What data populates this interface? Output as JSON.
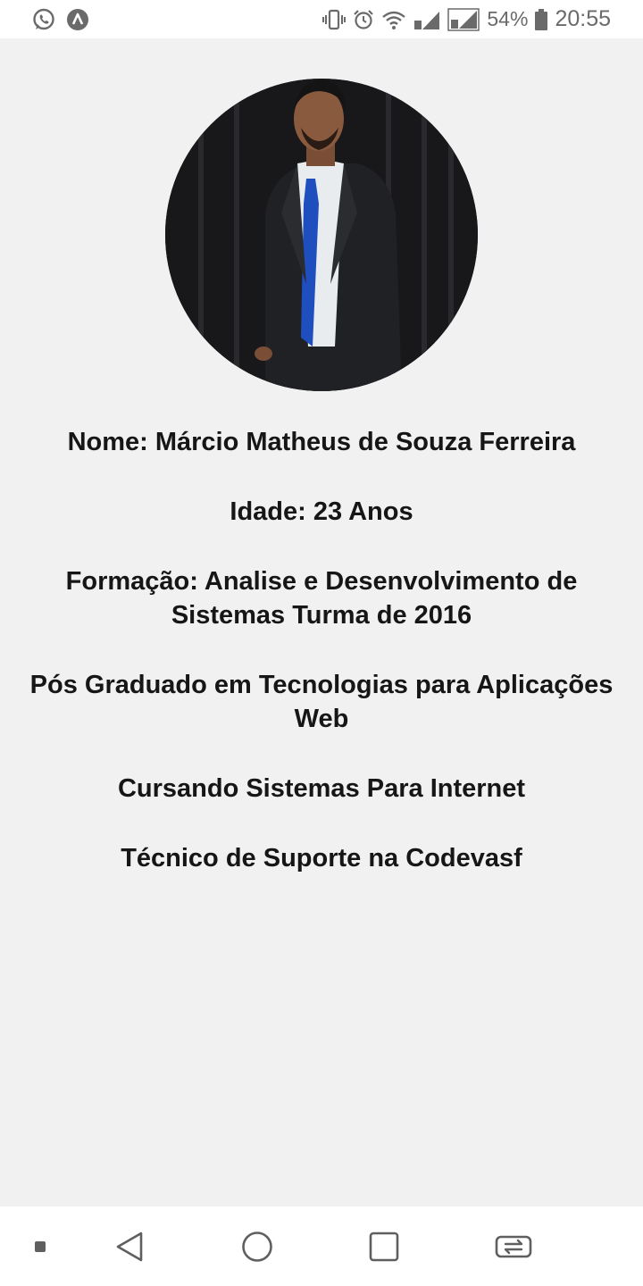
{
  "status_bar": {
    "left_icons": [
      "whatsapp-icon",
      "app-notification-icon"
    ],
    "right_icons": [
      "vibrate-icon",
      "alarm-icon",
      "wifi-icon",
      "signal-sim1-icon",
      "signal-sim2-icon",
      "battery-icon"
    ],
    "battery_percent": "54%",
    "time": "20:55"
  },
  "profile": {
    "photo": "profile-photo",
    "name_line": "Nome: Márcio Matheus de Souza Ferreira",
    "age_line": "Idade: 23 Anos",
    "education_line": "Formação: Analise e Desenvolvimento de Sistemas Turma de 2016",
    "postgrad_line": "Pós Graduado em Tecnologias para Aplicações Web",
    "studying_line": "Cursando Sistemas Para Internet",
    "job_line": "Técnico de Suporte na Codevasf"
  },
  "nav_bar": {
    "buttons": [
      "menu-dot-icon",
      "back-icon",
      "home-icon",
      "recents-icon",
      "switch-apps-icon"
    ]
  },
  "colors": {
    "background": "#f1f1f1",
    "bars": "#ffffff",
    "text": "#161616",
    "icons": "#6a6a6a"
  }
}
